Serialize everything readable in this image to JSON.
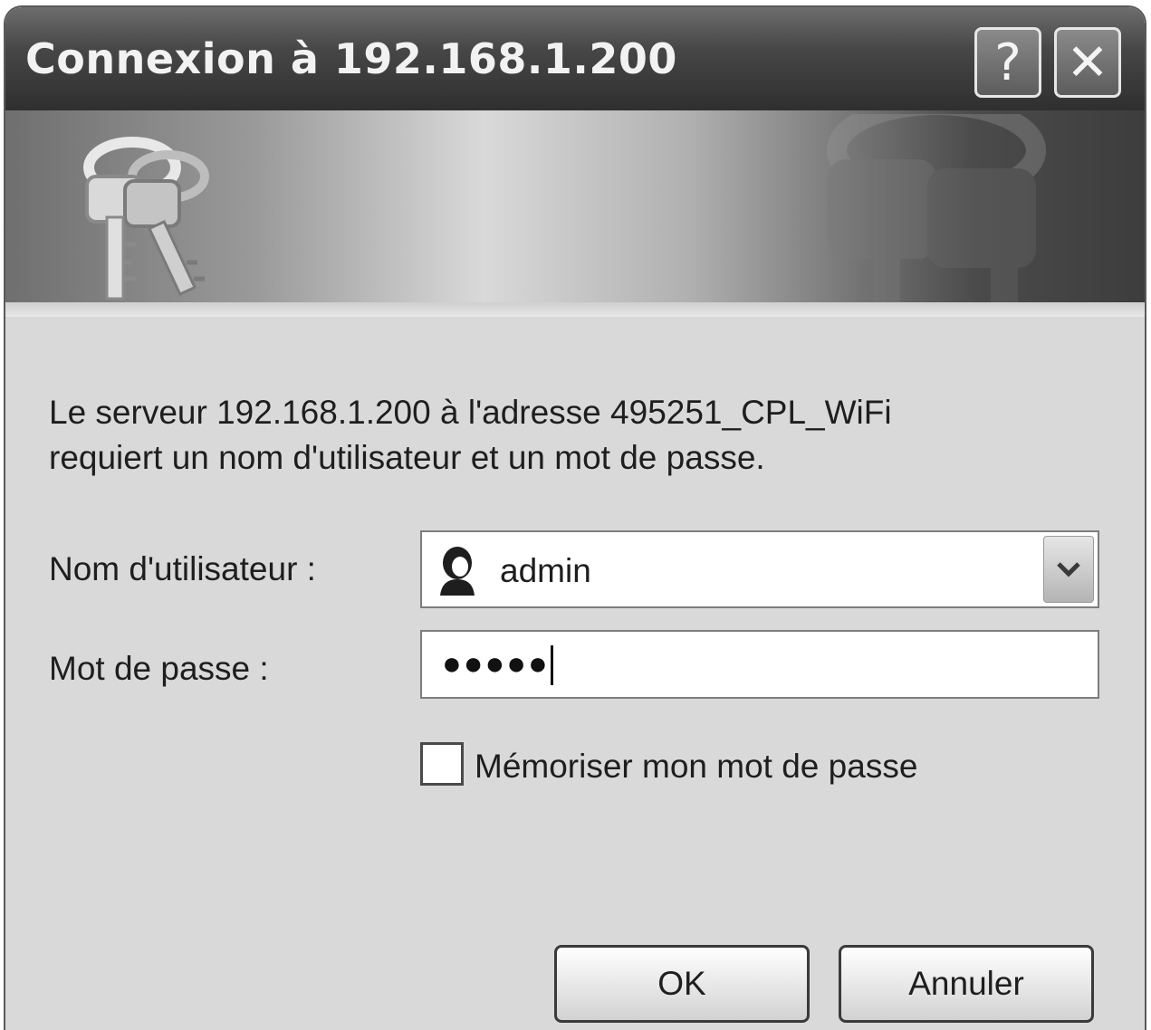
{
  "window": {
    "title": "Connexion à 192.168.1.200",
    "help_label": "?",
    "close_label": "✕"
  },
  "message": {
    "line1": "Le serveur 192.168.1.200 à l'adresse 495251_CPL_WiFi",
    "line2": "requiert un nom d'utilisateur et un mot de passe."
  },
  "form": {
    "username_label": "Nom d'utilisateur :",
    "username_value": "admin",
    "password_label": "Mot de passe :",
    "password_mask": "●●●●●",
    "remember_label": "Mémoriser mon mot de passe",
    "remember_checked": false
  },
  "buttons": {
    "ok": "OK",
    "cancel": "Annuler"
  },
  "icons": {
    "banner": "keys-icon",
    "user": "user-icon",
    "dropdown": "chevron-down-icon"
  }
}
